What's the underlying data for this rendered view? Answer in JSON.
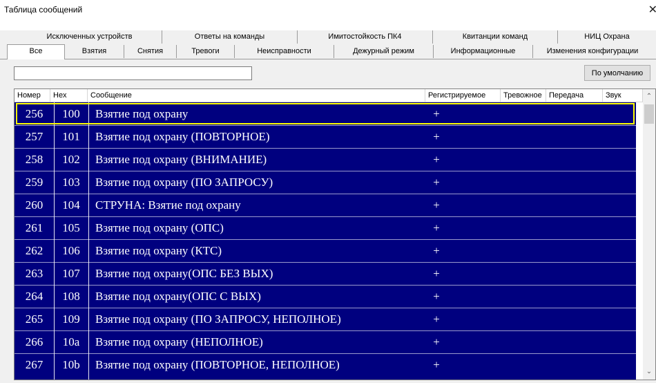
{
  "window": {
    "title": "Таблица сообщений",
    "close_glyph": "✕"
  },
  "tabs": {
    "row1": [
      "Исключенных устройств",
      "Ответы на команды",
      "Имитостойкость ПК4",
      "Квитанции команд",
      "НИЦ Охрана"
    ],
    "row2": [
      "Все",
      "Взятия",
      "Снятия",
      "Тревоги",
      "Неисправности",
      "Дежурный режим",
      "Информационные",
      "Изменения конфигурации"
    ],
    "active": "Все"
  },
  "filter": {
    "value": "",
    "default_button": "По умолчанию"
  },
  "table": {
    "columns": [
      "Номер",
      "Hex",
      "Сообщение",
      "Регистрируемое",
      "Тревожное",
      "Передача",
      "Звук"
    ],
    "rows": [
      {
        "num": "256",
        "hex": "100",
        "msg": "Взятие под охрану",
        "reg": "+"
      },
      {
        "num": "257",
        "hex": "101",
        "msg": "Взятие под охрану (ПОВТОРНОЕ)",
        "reg": "+"
      },
      {
        "num": "258",
        "hex": "102",
        "msg": "Взятие под охрану (ВНИМАНИЕ)",
        "reg": "+"
      },
      {
        "num": "259",
        "hex": "103",
        "msg": "Взятие под охрану (ПО ЗАПРОСУ)",
        "reg": "+"
      },
      {
        "num": "260",
        "hex": "104",
        "msg": "СТРУНА: Взятие под охрану",
        "reg": "+"
      },
      {
        "num": "261",
        "hex": "105",
        "msg": "Взятие под охрану (ОПС)",
        "reg": "+"
      },
      {
        "num": "262",
        "hex": "106",
        "msg": "Взятие под охрану (КТС)",
        "reg": "+"
      },
      {
        "num": "263",
        "hex": "107",
        "msg": "Взятие под охрану(ОПС БЕЗ ВЫХ)",
        "reg": "+"
      },
      {
        "num": "264",
        "hex": "108",
        "msg": "Взятие под охрану(ОПС С ВЫХ)",
        "reg": "+"
      },
      {
        "num": "265",
        "hex": "109",
        "msg": "Взятие под охрану (ПО ЗАПРОСУ, НЕПОЛНОЕ)",
        "reg": "+"
      },
      {
        "num": "266",
        "hex": "10a",
        "msg": "Взятие под охрану (НЕПОЛНОЕ)",
        "reg": "+"
      },
      {
        "num": "267",
        "hex": "10b",
        "msg": "Взятие под охрану (ПОВТОРНОЕ, НЕПОЛНОЕ)",
        "reg": "+"
      }
    ],
    "selected_row": "256",
    "colors": {
      "row_bg": "#00007f",
      "focus_border": "#ffff00",
      "text": "#ffffff"
    }
  },
  "scrollbar": {
    "up_icon": "chevron-up-icon",
    "down_icon": "chevron-down-icon",
    "up_glyph": "⌃",
    "down_glyph": "⌄"
  }
}
